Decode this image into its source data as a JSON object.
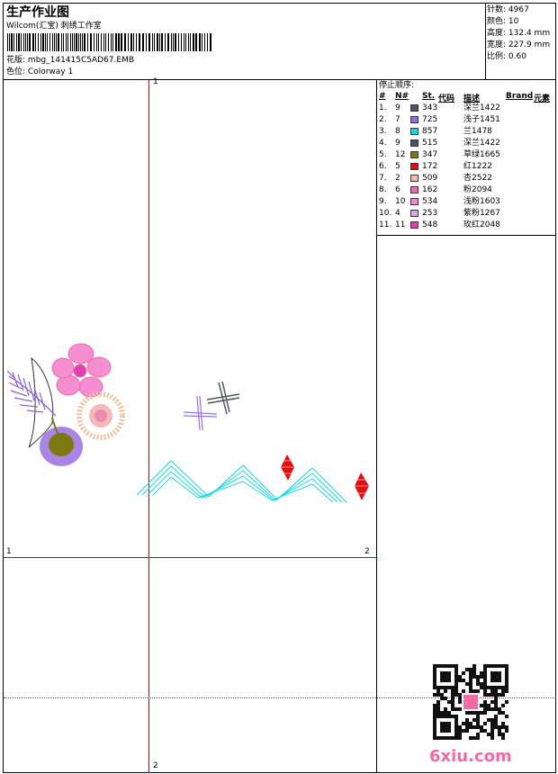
{
  "header": {
    "title": "生产作业图",
    "company": "Wilcom(汇宝) 刺绣工作室",
    "design_label": "花版:",
    "design_name": "mbg_141415C5AD67.EMB",
    "colorway_label": "色位:",
    "colorway_name": "Colorway 1"
  },
  "stats": [
    {
      "label": "针数:",
      "value": "4967"
    },
    {
      "label": "颜色:",
      "value": "10"
    },
    {
      "label": "高度:",
      "value": "132.4 mm"
    },
    {
      "label": "宽度:",
      "value": "227.9 mm"
    },
    {
      "label": "比例:",
      "value": "0.60"
    }
  ],
  "legend": {
    "title": "停止顺序:",
    "columns": [
      "#",
      "N#",
      "St.",
      "代码",
      "描述",
      "Brand",
      "元素"
    ],
    "rows": [
      {
        "num": "1.",
        "n": "9",
        "color": "#4a5560",
        "code": "343",
        "desc": "深兰1422"
      },
      {
        "num": "2.",
        "n": "7",
        "color": "#9a6ee0",
        "code": "725",
        "desc": "浅子1451"
      },
      {
        "num": "3.",
        "n": "8",
        "color": "#18d8e8",
        "code": "857",
        "desc": "兰1478"
      },
      {
        "num": "4.",
        "n": "9",
        "color": "#4a5560",
        "code": "515",
        "desc": "深兰1422"
      },
      {
        "num": "5.",
        "n": "12",
        "color": "#7a7a10",
        "code": "347",
        "desc": "草绿1665"
      },
      {
        "num": "6.",
        "n": "5",
        "color": "#e01010",
        "code": "172",
        "desc": "红1222"
      },
      {
        "num": "7.",
        "n": "2",
        "color": "#f2c0a0",
        "code": "509",
        "desc": "杏2522"
      },
      {
        "num": "8.",
        "n": "6",
        "color": "#ec6ea8",
        "code": "162",
        "desc": "粉2094"
      },
      {
        "num": "9.",
        "n": "10",
        "color": "#f08ad8",
        "code": "534",
        "desc": "浅粉1603"
      },
      {
        "num": "10.",
        "n": "4",
        "color": "#d8a8e8",
        "code": "253",
        "desc": "紫粉1267"
      },
      {
        "num": "11.",
        "n": "11",
        "color": "#e040b0",
        "code": "548",
        "desc": "玫红2048"
      }
    ]
  },
  "markers": {
    "top": "1",
    "bottom": "2",
    "left": "1",
    "right": "2"
  },
  "watermark": "6xiu.com"
}
